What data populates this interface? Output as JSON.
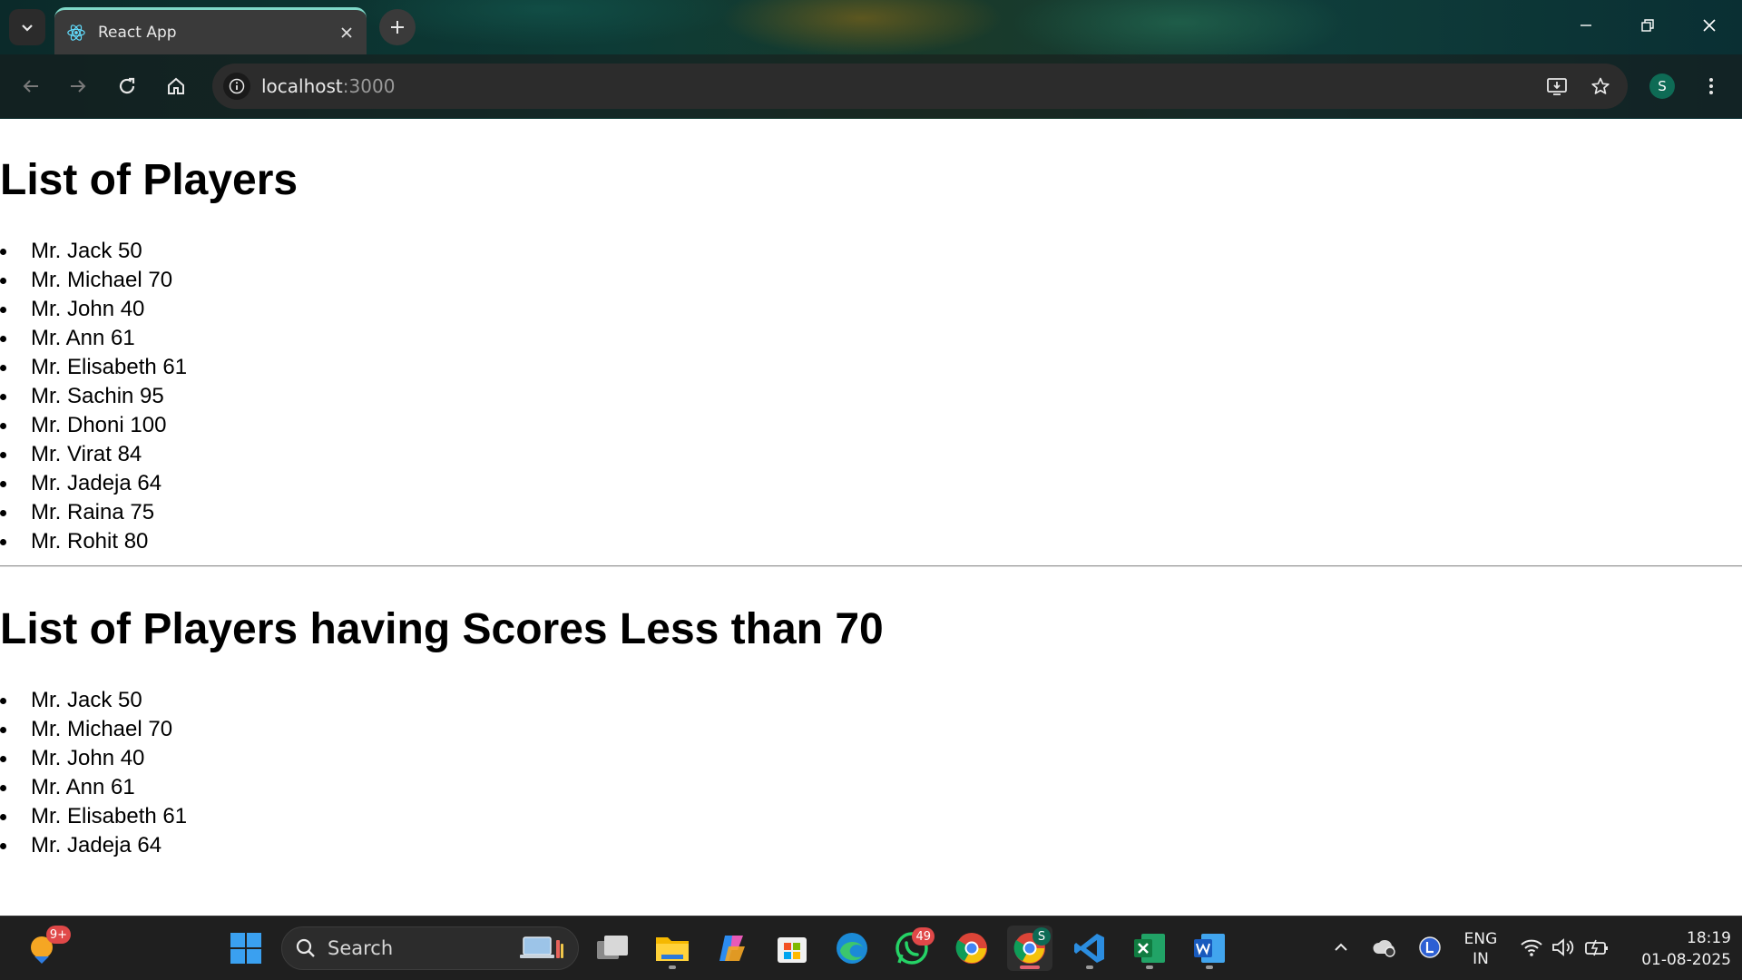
{
  "browser": {
    "tab_title": "React App",
    "url_host": "localhost",
    "url_port": ":3000",
    "profile_initial": "S"
  },
  "page": {
    "heading_all": "List of Players",
    "players_all": [
      "Mr. Jack 50",
      "Mr. Michael 70",
      "Mr. John 40",
      "Mr. Ann 61",
      "Mr. Elisabeth 61",
      "Mr. Sachin 95",
      "Mr. Dhoni 100",
      "Mr. Virat 84",
      "Mr. Jadeja 64",
      "Mr. Raina 75",
      "Mr. Rohit 80"
    ],
    "heading_filtered": "List of Players having Scores Less than 70",
    "players_filtered": [
      "Mr. Jack 50",
      "Mr. Michael 70",
      "Mr. John 40",
      "Mr. Ann 61",
      "Mr. Elisabeth 61",
      "Mr. Jadeja 64"
    ]
  },
  "taskbar": {
    "weather_badge": "9+",
    "search_label": "Search",
    "whatsapp_badge": "49",
    "chrome_profile_badge": "S",
    "language_line1": "ENG",
    "language_line2": "IN",
    "time": "18:19",
    "date": "01-08-2025"
  },
  "colors": {
    "tab_accent": "#7fd8c8",
    "profile_bg": "#0e6b55",
    "active_indicator": "#e4626f",
    "badge_red": "#e04848"
  }
}
